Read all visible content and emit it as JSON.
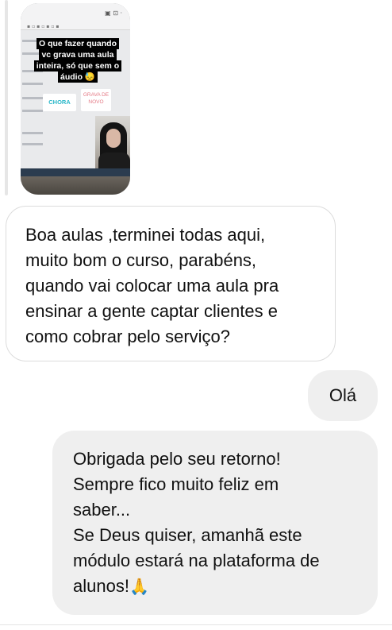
{
  "story": {
    "caption": "O que fazer quando vc grava uma aula inteira, só que sem o áudio 😓",
    "chip_left": "CHORA",
    "chip_right_line1": "GRAVA DE",
    "chip_right_line2": "NOVO"
  },
  "messages": [
    {
      "direction": "incoming",
      "text": "Boa aulas ,terminei todas aqui,\nmuito bom o curso, parabéns,\nquando vai colocar uma aula pra\nensinar a gente captar clientes e\ncomo cobrar pelo serviço?"
    },
    {
      "direction": "outgoing",
      "text": "Olá"
    },
    {
      "direction": "outgoing",
      "text": "Obrigada pelo seu retorno!\nSempre fico muito feliz em\nsaber...\nSe Deus quiser, amanhã este\nmódulo estará na plataforma de\nalunos!",
      "emoji": "folded-hands"
    }
  ],
  "colors": {
    "incoming_bubble_border": "#dcdcdc",
    "outgoing_bubble_bg": "#efefef"
  }
}
